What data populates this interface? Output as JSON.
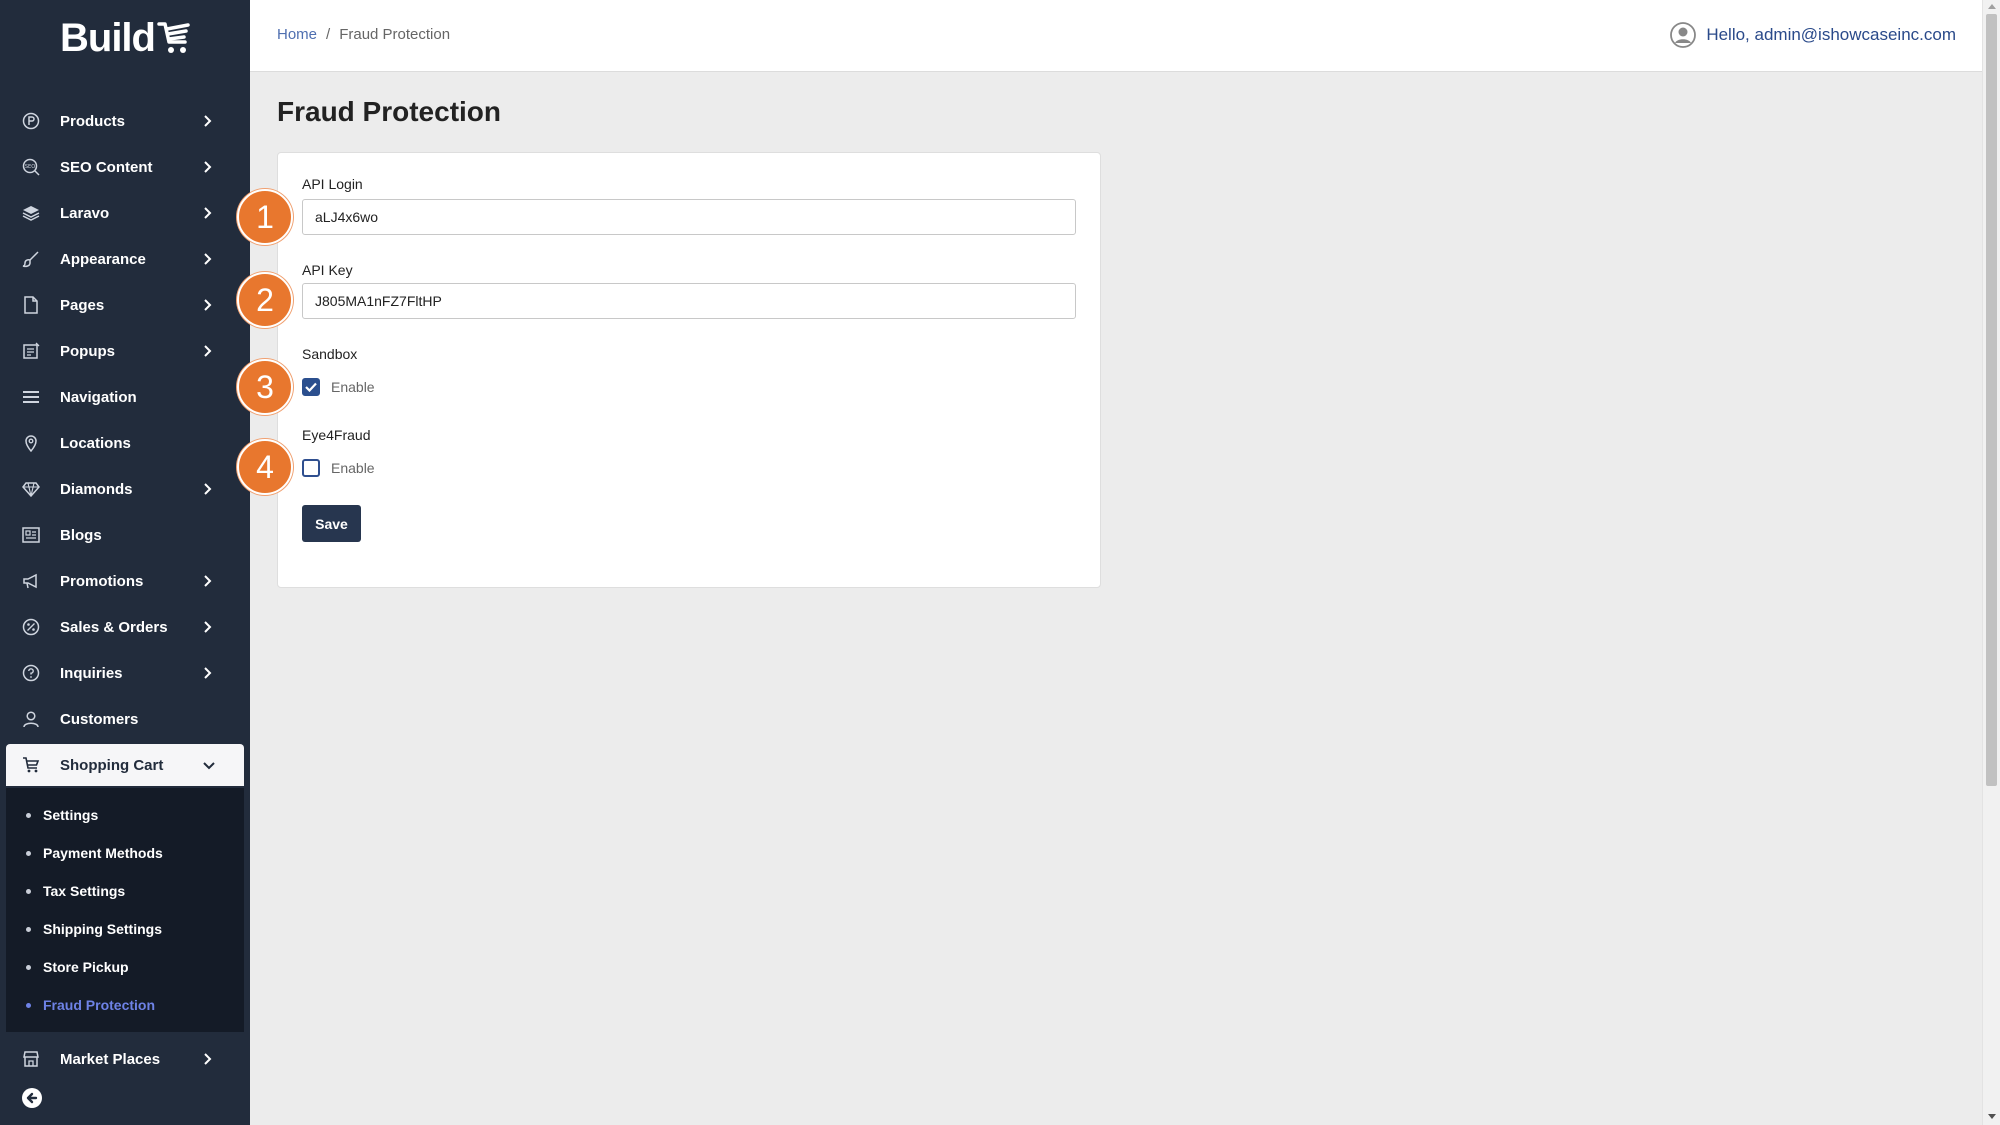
{
  "app": {
    "logo_text": "Build"
  },
  "sidebar": {
    "items": [
      {
        "label": "Products",
        "icon": "product-circle-icon",
        "chevron": true
      },
      {
        "label": "SEO Content",
        "icon": "seo-icon",
        "chevron": true
      },
      {
        "label": "Laravo",
        "icon": "layers-icon",
        "chevron": true
      },
      {
        "label": "Appearance",
        "icon": "brush-icon",
        "chevron": true
      },
      {
        "label": "Pages",
        "icon": "page-icon",
        "chevron": true
      },
      {
        "label": "Popups",
        "icon": "popup-icon",
        "chevron": true
      },
      {
        "label": "Navigation",
        "icon": "menu-icon",
        "chevron": false
      },
      {
        "label": "Locations",
        "icon": "location-pin-icon",
        "chevron": false
      },
      {
        "label": "Diamonds",
        "icon": "diamond-icon",
        "chevron": true
      },
      {
        "label": "Blogs",
        "icon": "blog-icon",
        "chevron": false
      },
      {
        "label": "Promotions",
        "icon": "megaphone-icon",
        "chevron": true
      },
      {
        "label": "Sales & Orders",
        "icon": "percent-icon",
        "chevron": true
      },
      {
        "label": "Inquiries",
        "icon": "question-icon",
        "chevron": true
      },
      {
        "label": "Customers",
        "icon": "user-icon",
        "chevron": false
      }
    ],
    "active_item": {
      "label": "Shopping Cart",
      "icon": "cart-icon"
    },
    "submenu": [
      {
        "label": "Settings"
      },
      {
        "label": "Payment Methods"
      },
      {
        "label": "Tax Settings"
      },
      {
        "label": "Shipping Settings"
      },
      {
        "label": "Store Pickup"
      },
      {
        "label": "Fraud Protection",
        "current": true
      }
    ],
    "after_items": [
      {
        "label": "Market Places",
        "icon": "store-icon",
        "chevron": true
      }
    ]
  },
  "header": {
    "breadcrumb": {
      "home": "Home",
      "separator": "/",
      "current": "Fraud Protection"
    },
    "user_greeting": "Hello, admin@ishowcaseinc.com"
  },
  "main": {
    "title": "Fraud Protection",
    "form": {
      "api_login_label": "API Login",
      "api_login_value": "aLJ4x6wo",
      "api_key_label": "API Key",
      "api_key_value": "J805MA1nFZ7FltHP",
      "sandbox_label": "Sandbox",
      "sandbox_option": "Enable",
      "sandbox_checked": true,
      "eye4fraud_label": "Eye4Fraud",
      "eye4fraud_option": "Enable",
      "eye4fraud_checked": false,
      "save_label": "Save"
    },
    "markers": [
      "1",
      "2",
      "3",
      "4"
    ]
  },
  "colors": {
    "sidebar_bg": "#222c3c",
    "submenu_bg": "#141b27",
    "accent_link": "#6e82e6",
    "marker": "#e8772e",
    "button": "#27364f"
  }
}
